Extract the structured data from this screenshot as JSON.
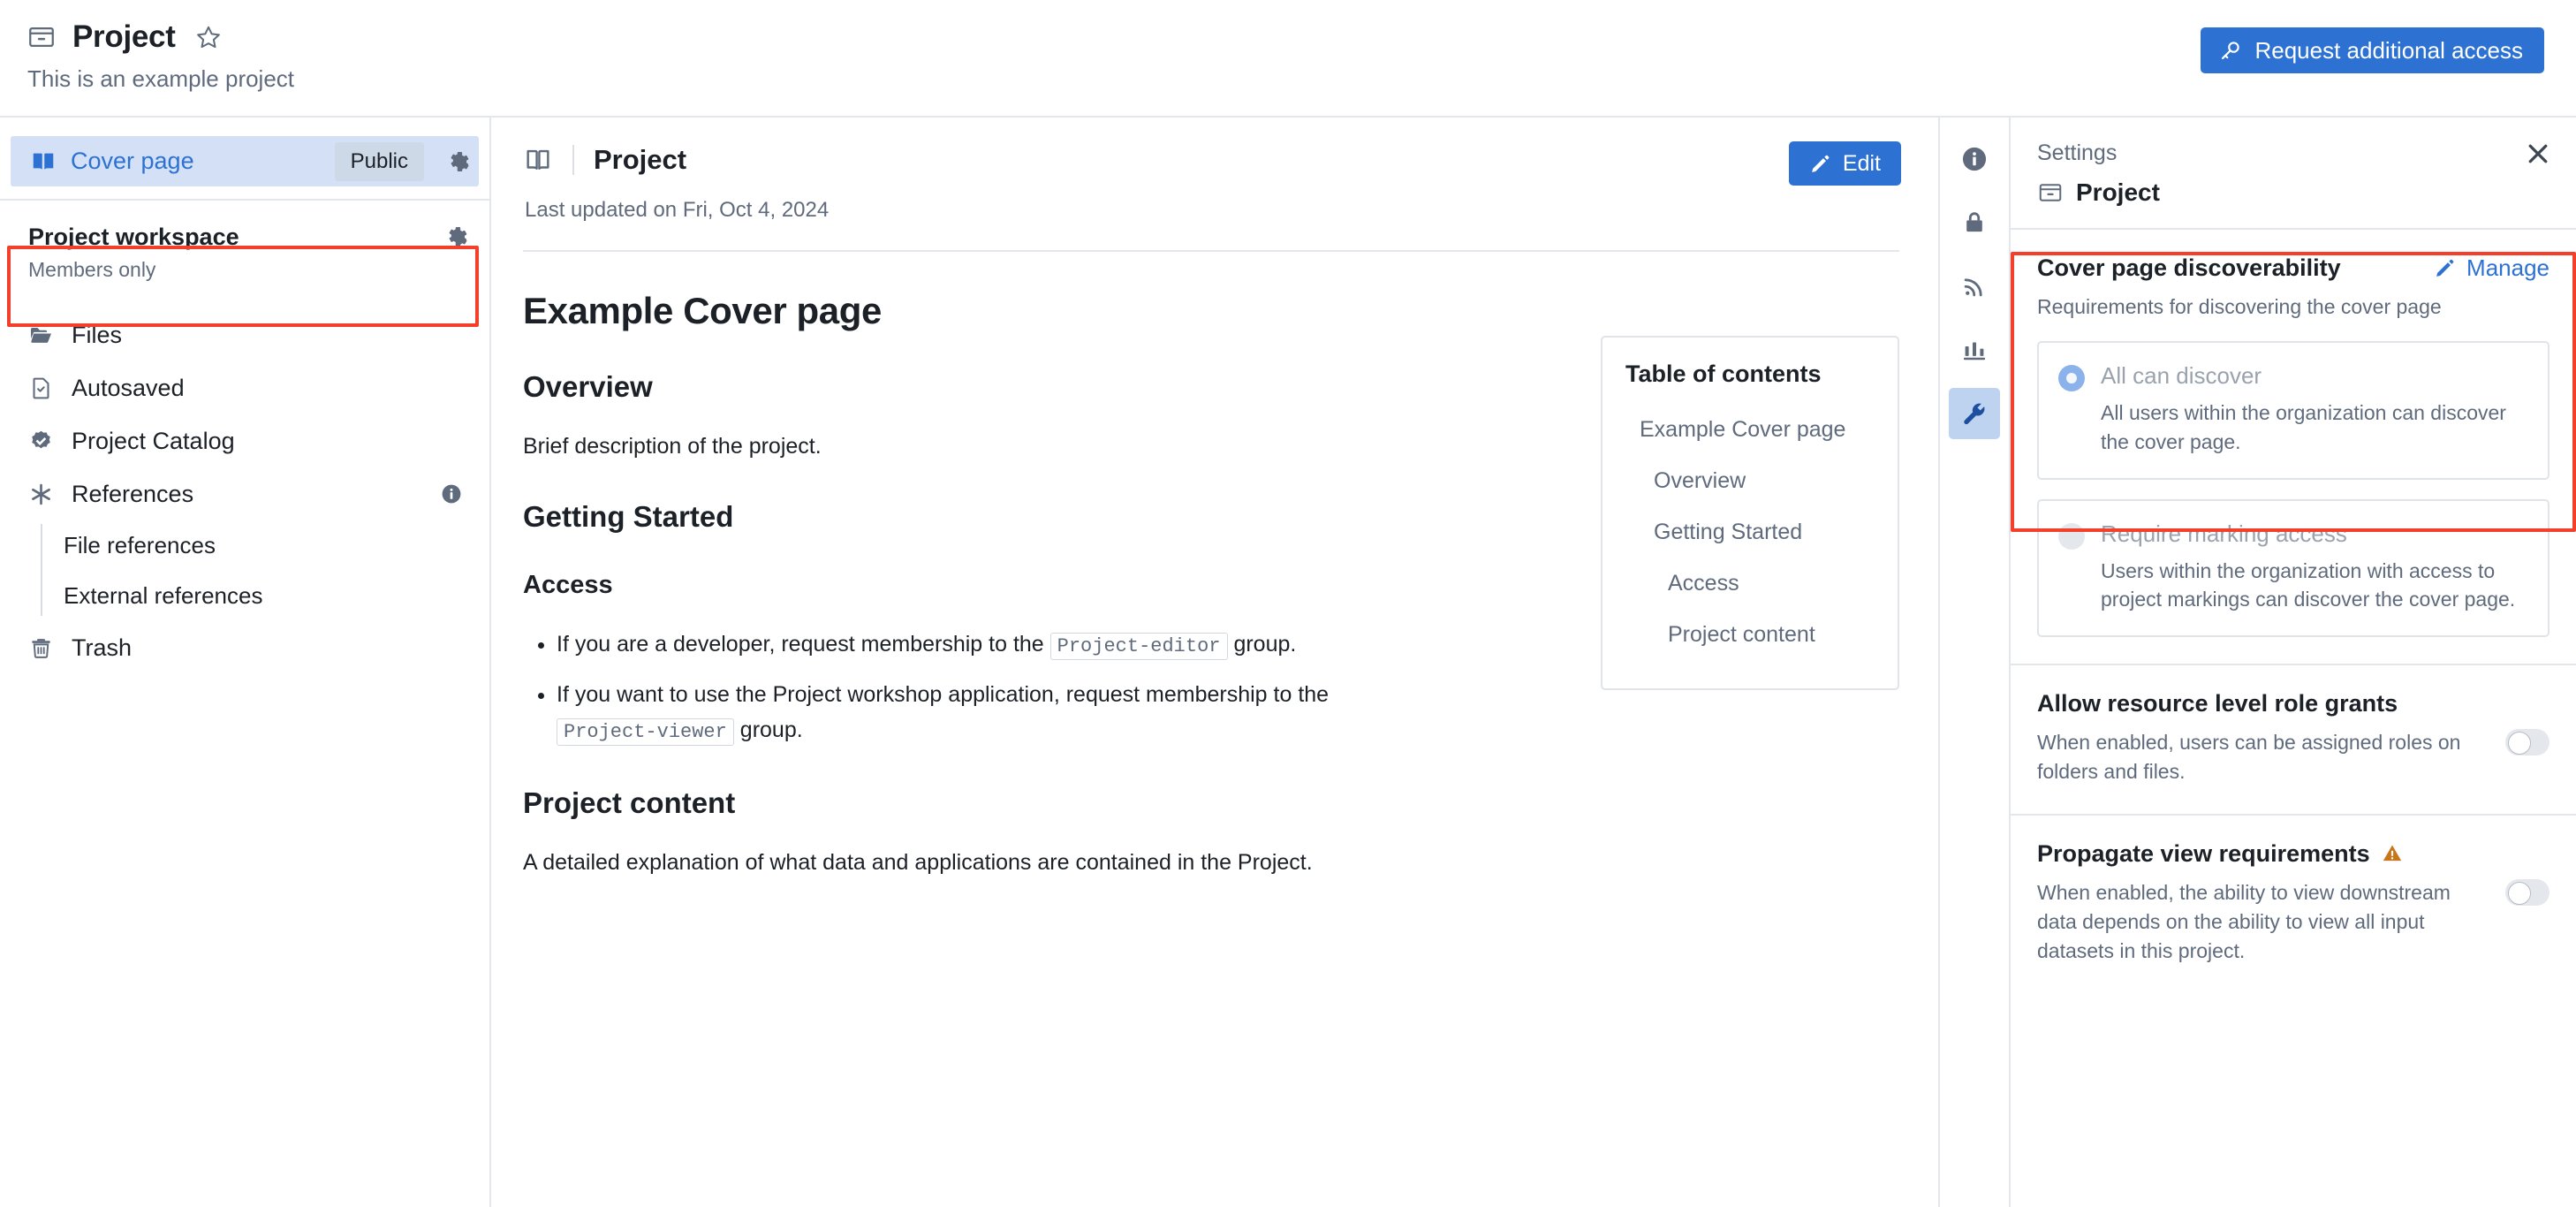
{
  "header": {
    "project_icon": "project-box-icon",
    "title": "Project",
    "star_icon": "star-icon",
    "subtitle": "This is an example project",
    "request_access_label": "Request additional access",
    "request_access_icon": "key-icon"
  },
  "sidebar": {
    "cover_page": {
      "icon": "book-icon",
      "label": "Cover page",
      "badge": "Public",
      "gear_icon": "gear-icon"
    },
    "workspace": {
      "title": "Project workspace",
      "subtitle": "Members only",
      "gear_icon": "gear-icon"
    },
    "items": [
      {
        "label": "Files",
        "icon": "folder-icon"
      },
      {
        "label": "Autosaved",
        "icon": "document-check-icon"
      },
      {
        "label": "Project Catalog",
        "icon": "verified-check-icon"
      },
      {
        "label": "References",
        "icon": "asterisk-icon",
        "info_icon": "info-icon"
      }
    ],
    "subitems": [
      {
        "label": "File references"
      },
      {
        "label": "External references"
      }
    ],
    "trash": {
      "label": "Trash",
      "icon": "trash-icon"
    }
  },
  "document": {
    "icon": "book-icon",
    "title": "Project",
    "edit_label": "Edit",
    "edit_icon": "pencil-icon",
    "last_updated": "Last updated on Fri, Oct 4, 2024",
    "h1": "Example Cover page",
    "overview_heading": "Overview",
    "overview_text": "Brief description of the project.",
    "getting_started_heading": "Getting Started",
    "access_heading": "Access",
    "bullet1_before": "If you are a developer, request membership to the ",
    "bullet1_code": "Project-editor",
    "bullet1_after": " group.",
    "bullet2_before": "If you want to use the Project workshop application, request membership to the ",
    "bullet2_code": "Project-viewer",
    "bullet2_after": " group.",
    "project_content_heading": "Project content",
    "project_content_text": "A detailed explanation of what data and applications are contained in the Project."
  },
  "toc": {
    "title": "Table of contents",
    "items": [
      {
        "label": "Example Cover page",
        "level": 1
      },
      {
        "label": "Overview",
        "level": 2
      },
      {
        "label": "Getting Started",
        "level": 2
      },
      {
        "label": "Access",
        "level": 3
      },
      {
        "label": "Project content",
        "level": 3
      }
    ]
  },
  "rail": {
    "items": [
      {
        "icon": "info-icon",
        "active": false
      },
      {
        "icon": "lock-icon",
        "active": false
      },
      {
        "icon": "rss-feed-icon",
        "active": false
      },
      {
        "icon": "bar-chart-icon",
        "active": false
      },
      {
        "icon": "wrench-icon",
        "active": true
      }
    ],
    "active_color": "#bed3f0"
  },
  "settings": {
    "kicker": "Settings",
    "project_icon": "project-box-icon",
    "project_name": "Project",
    "close_icon": "close-icon",
    "discoverability": {
      "title": "Cover page discoverability",
      "manage_label": "Manage",
      "manage_icon": "pencil-icon",
      "description": "Requirements for discovering the cover page",
      "options": [
        {
          "label": "All can discover",
          "description": "All users within the organization can discover the cover page.",
          "selected": true
        },
        {
          "label": "Require marking access",
          "description": "Users within the organization with access to project markings can discover the cover page.",
          "selected": false
        }
      ]
    },
    "role_grants": {
      "title": "Allow resource level role grants",
      "description": "When enabled, users can be assigned roles on folders and files.",
      "enabled": false
    },
    "propagate": {
      "title": "Propagate view requirements",
      "warning_icon": "warning-triangle-icon",
      "description": "When enabled, the ability to view downstream data depends on the ability to view all input datasets in this project.",
      "enabled": false
    }
  },
  "colors": {
    "accent": "#2d72d2",
    "annotation": "#f4402a",
    "muted": "#5f6b7c",
    "selected_bg": "#d3e0f5",
    "warning": "#c87619"
  }
}
